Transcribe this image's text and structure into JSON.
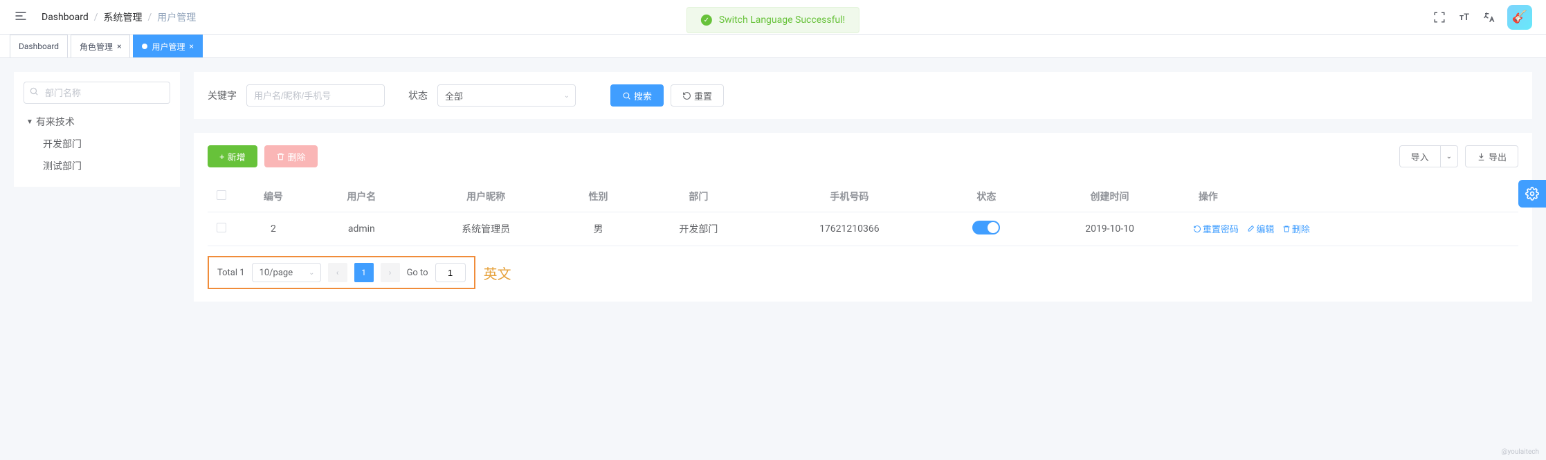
{
  "breadcrumb": {
    "root": "Dashboard",
    "l1": "系统管理",
    "l2": "用户管理"
  },
  "toast": {
    "message": "Switch Language Successful!"
  },
  "tabs": {
    "t0": {
      "label": "Dashboard"
    },
    "t1": {
      "label": "角色管理"
    },
    "t2": {
      "label": "用户管理"
    }
  },
  "sidebar": {
    "search_placeholder": "部门名称",
    "tree": {
      "root": "有来技术",
      "c1": "开发部门",
      "c2": "测试部门"
    }
  },
  "filters": {
    "keyword_label": "关键字",
    "keyword_placeholder": "用户名/昵称/手机号",
    "status_label": "状态",
    "status_value": "全部",
    "search_btn": "搜索",
    "reset_btn": "重置"
  },
  "actions": {
    "add": "新增",
    "delete": "删除",
    "import": "导入",
    "export": "导出"
  },
  "table": {
    "headers": {
      "id": "编号",
      "username": "用户名",
      "nickname": "用户昵称",
      "gender": "性别",
      "dept": "部门",
      "phone": "手机号码",
      "status": "状态",
      "created": "创建时间",
      "ops": "操作"
    },
    "row0": {
      "id": "2",
      "username": "admin",
      "nickname": "系统管理员",
      "gender": "男",
      "dept": "开发部门",
      "phone": "17621210366",
      "created": "2019-10-10"
    },
    "row_actions": {
      "reset_pwd": "重置密码",
      "edit": "编辑",
      "delete": "删除"
    }
  },
  "pagination": {
    "total_label": "Total 1",
    "page_size": "10/page",
    "current": "1",
    "goto_label": "Go to",
    "goto_value": "1"
  },
  "annotation": "英文",
  "watermark": "@youlaitech"
}
